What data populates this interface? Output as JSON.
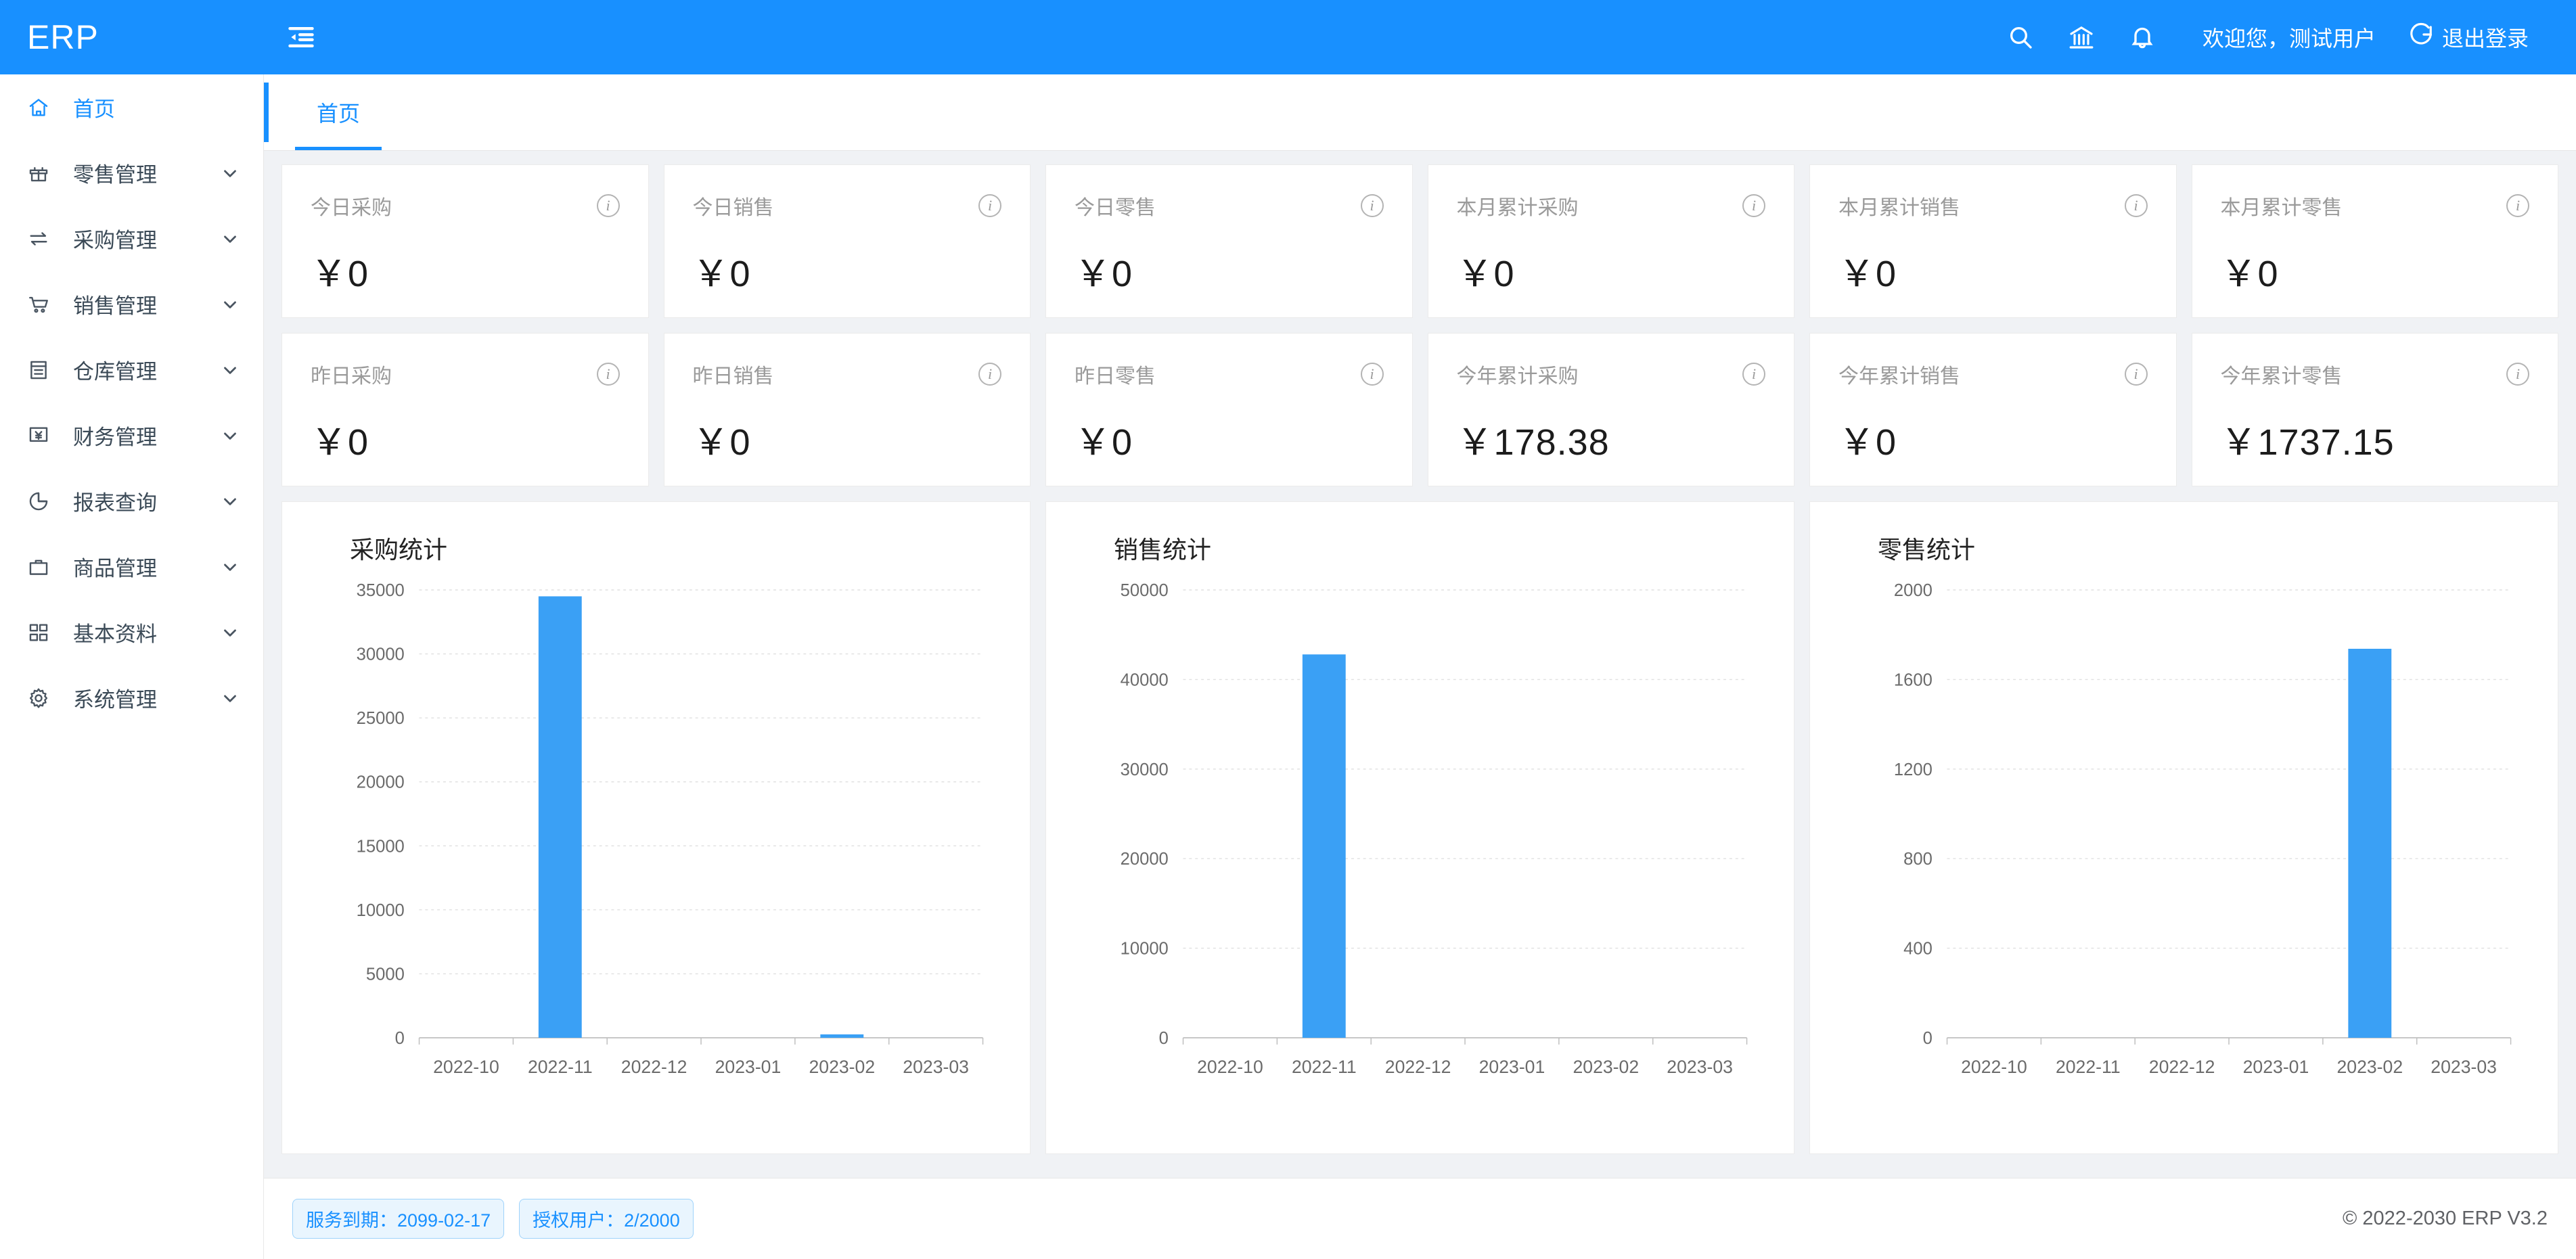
{
  "header": {
    "brand": "ERP",
    "fold_icon": "menu-fold-icon",
    "search_icon": "search-icon",
    "bank_icon": "bank-icon",
    "bell_icon": "bell-icon",
    "welcome": "欢迎您，测试用户",
    "logout_label": "退出登录",
    "logout_icon": "logout-icon",
    "bg_color": "#1890ff"
  },
  "sidebar": {
    "items": [
      {
        "label": "首页",
        "icon": "home-icon",
        "active": true,
        "has_caret": false
      },
      {
        "label": "零售管理",
        "icon": "gift-icon",
        "active": false,
        "has_caret": true
      },
      {
        "label": "采购管理",
        "icon": "swap-icon",
        "active": false,
        "has_caret": true
      },
      {
        "label": "销售管理",
        "icon": "cart-icon",
        "active": false,
        "has_caret": true
      },
      {
        "label": "仓库管理",
        "icon": "warehouse-icon",
        "active": false,
        "has_caret": true
      },
      {
        "label": "财务管理",
        "icon": "money-icon",
        "active": false,
        "has_caret": true
      },
      {
        "label": "报表查询",
        "icon": "pie-chart-icon",
        "active": false,
        "has_caret": true
      },
      {
        "label": "商品管理",
        "icon": "briefcase-icon",
        "active": false,
        "has_caret": true
      },
      {
        "label": "基本资料",
        "icon": "blocks-icon",
        "active": false,
        "has_caret": true
      },
      {
        "label": "系统管理",
        "icon": "gear-icon",
        "active": false,
        "has_caret": true
      }
    ]
  },
  "tabs": [
    {
      "label": "首页",
      "active": true
    }
  ],
  "stats": {
    "row1": [
      {
        "title": "今日采购",
        "value": "￥0"
      },
      {
        "title": "今日销售",
        "value": "￥0"
      },
      {
        "title": "今日零售",
        "value": "￥0"
      },
      {
        "title": "本月累计采购",
        "value": "￥0"
      },
      {
        "title": "本月累计销售",
        "value": "￥0"
      },
      {
        "title": "本月累计零售",
        "value": "￥0"
      }
    ],
    "row2": [
      {
        "title": "昨日采购",
        "value": "￥0"
      },
      {
        "title": "昨日销售",
        "value": "￥0"
      },
      {
        "title": "昨日零售",
        "value": "￥0"
      },
      {
        "title": "今年累计采购",
        "value": "￥178.38"
      },
      {
        "title": "今年累计销售",
        "value": "￥0"
      },
      {
        "title": "今年累计零售",
        "value": "￥1737.15"
      }
    ]
  },
  "chart_data": [
    {
      "type": "bar",
      "title": "采购统计",
      "categories": [
        "2022-10",
        "2022-11",
        "2022-12",
        "2023-01",
        "2023-02",
        "2023-03"
      ],
      "values": [
        0,
        34500,
        0,
        0,
        178.38,
        0
      ],
      "yticks": [
        0,
        5000,
        10000,
        15000,
        20000,
        25000,
        30000,
        35000
      ],
      "ylim": [
        0,
        35000
      ],
      "xlabel": "",
      "ylabel": "",
      "grid": true,
      "legend": "none",
      "bar_color": "#3aa0f5"
    },
    {
      "type": "bar",
      "title": "销售统计",
      "categories": [
        "2022-10",
        "2022-11",
        "2022-12",
        "2023-01",
        "2023-02",
        "2023-03"
      ],
      "values": [
        0,
        42800,
        0,
        0,
        0,
        0
      ],
      "yticks": [
        0,
        10000,
        20000,
        30000,
        40000,
        50000
      ],
      "ylim": [
        0,
        50000
      ],
      "xlabel": "",
      "ylabel": "",
      "grid": true,
      "legend": "none",
      "bar_color": "#3aa0f5"
    },
    {
      "type": "bar",
      "title": "零售统计",
      "categories": [
        "2022-10",
        "2022-11",
        "2022-12",
        "2023-01",
        "2023-02",
        "2023-03"
      ],
      "values": [
        0,
        0,
        0,
        0,
        1737.15,
        0
      ],
      "yticks": [
        0,
        400,
        800,
        1200,
        1600,
        2000
      ],
      "ylim": [
        0,
        2000
      ],
      "xlabel": "",
      "ylabel": "",
      "grid": true,
      "legend": "none",
      "bar_color": "#3aa0f5"
    }
  ],
  "footer": {
    "service_expiry": "服务到期：2099-02-17",
    "licensed_users": "授权用户：2/2000",
    "copyright": "© 2022-2030 ERP V3.2"
  }
}
